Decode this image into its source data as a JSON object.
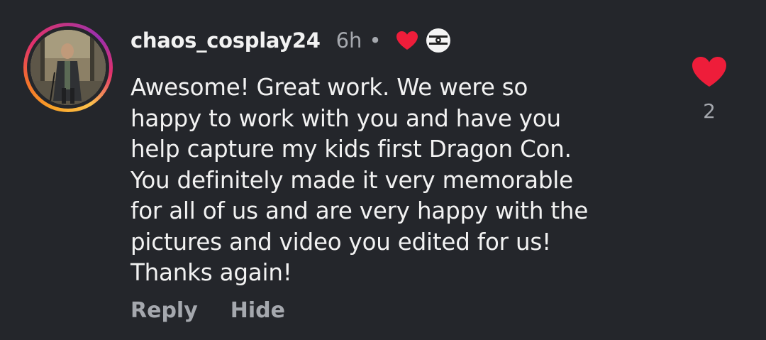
{
  "comment": {
    "username": "chaos_cosplay24",
    "time_ago": "6h",
    "separator": "•",
    "text": "Awesome!  Great work.  We were so\nhappy to work with you and have you\nhelp capture my kids first Dragon Con.\nYou definitely made it very memorable\nfor all of us and are very happy with the\npictures and video you edited for us!\nThanks again!",
    "like_count": "2",
    "liked_by_creator_icon": "red-heart-icon",
    "creator_avatar_icon": "creator-avatar-icon"
  },
  "actions": {
    "reply_label": "Reply",
    "hide_label": "Hide"
  },
  "colors": {
    "background": "#24262b",
    "text_primary": "#f2f2f2",
    "text_secondary": "#a5a8ae",
    "heart": "#ee1d3a"
  }
}
